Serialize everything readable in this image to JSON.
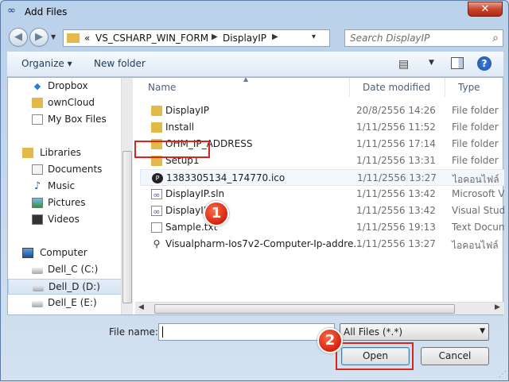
{
  "window": {
    "title": "Add Files",
    "close_glyph": "✕"
  },
  "navbar": {
    "back_glyph": "◀",
    "forward_glyph": "▶",
    "address": {
      "overflow": "«",
      "segments": [
        "VS_CSHARP_WIN_FORM",
        "DisplayIP"
      ],
      "separator": "▶"
    },
    "search_placeholder": "Search DisplayIP"
  },
  "toolbar": {
    "organize_label": "Organize ▾",
    "new_folder_label": "New folder"
  },
  "nav_pane": {
    "items": [
      {
        "label": "Dropbox",
        "icon": "dropbox-icon"
      },
      {
        "label": "ownCloud",
        "icon": "folder-icon"
      },
      {
        "label": "My Box Files",
        "icon": "document-icon"
      },
      {
        "label": "Libraries",
        "icon": "libraries-icon"
      },
      {
        "label": "Documents",
        "icon": "documents-icon"
      },
      {
        "label": "Music",
        "icon": "music-icon"
      },
      {
        "label": "Pictures",
        "icon": "pictures-icon"
      },
      {
        "label": "Videos",
        "icon": "videos-icon"
      },
      {
        "label": "Computer",
        "icon": "computer-icon"
      },
      {
        "label": "Dell_C (C:)",
        "icon": "drive-icon"
      },
      {
        "label": "Dell_D (D:)",
        "icon": "drive-icon",
        "selected": true
      },
      {
        "label": "Dell_E (E:)",
        "icon": "drive-icon"
      }
    ]
  },
  "file_list": {
    "columns": [
      "Name",
      "Date modified",
      "Type"
    ],
    "rows": [
      {
        "name": "DisplayIP",
        "date": "20/8/2556 14:26",
        "type": "File folder",
        "icon": "folder-icon"
      },
      {
        "name": "Install",
        "date": "1/11/2556 11:52",
        "type": "File folder",
        "icon": "folder-icon"
      },
      {
        "name": "OHM_IP_ADDRESS",
        "date": "1/11/2556 17:14",
        "type": "File folder",
        "icon": "folder-icon"
      },
      {
        "name": "Setup1",
        "date": "1/11/2556 13:31",
        "type": "File folder",
        "icon": "folder-icon"
      },
      {
        "name": "1383305134_174770.ico",
        "date": "1/11/2556 13:27",
        "type": "ไอคอนไฟล์",
        "icon": "ico-file-icon"
      },
      {
        "name": "DisplayIP.sln",
        "date": "1/11/2556 13:42",
        "type": "Microsoft Vis",
        "icon": "sln-file-icon"
      },
      {
        "name": "DisplayIP",
        "date": "1/11/2556 13:42",
        "type": "Visual Studio",
        "icon": "vs-file-icon"
      },
      {
        "name": "Sample.txt",
        "date": "1/11/2556 19:13",
        "type": "Text Docum",
        "icon": "text-file-icon"
      },
      {
        "name": "Visualpharm-Ios7v2-Computer-Ip-addre...",
        "date": "1/11/2556 13:27",
        "type": "ไอคอนไฟล์",
        "icon": "ico-file-icon"
      }
    ]
  },
  "footer": {
    "file_name_label": "File name:",
    "file_name_value": "",
    "filter_value": "All Files (*.*)",
    "open_label": "Open",
    "cancel_label": "Cancel"
  },
  "annotations": {
    "step1": "1",
    "step2": "2"
  },
  "colors": {
    "highlight_red": "#d8261b",
    "badge_red": "#d4230e",
    "folder": "#e3b94a"
  }
}
